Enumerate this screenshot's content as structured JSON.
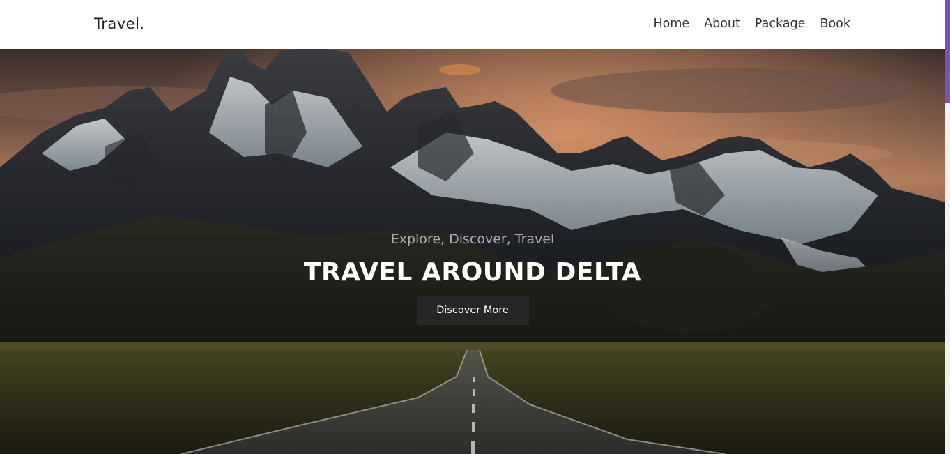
{
  "header": {
    "brand": "Travel.",
    "nav": [
      {
        "label": "Home"
      },
      {
        "label": "About"
      },
      {
        "label": "Package"
      },
      {
        "label": "Book"
      }
    ]
  },
  "hero": {
    "subtitle": "Explore, Discover, Travel",
    "title": "TRAVEL AROUND DELTA",
    "button_label": "Discover More",
    "image": "mountain-road-landscape"
  },
  "colors": {
    "header_bg": "#ffffff",
    "button_bg": "#262626",
    "scrollbar_thumb": "#7b4fc4",
    "title_text": "#ffffff"
  }
}
